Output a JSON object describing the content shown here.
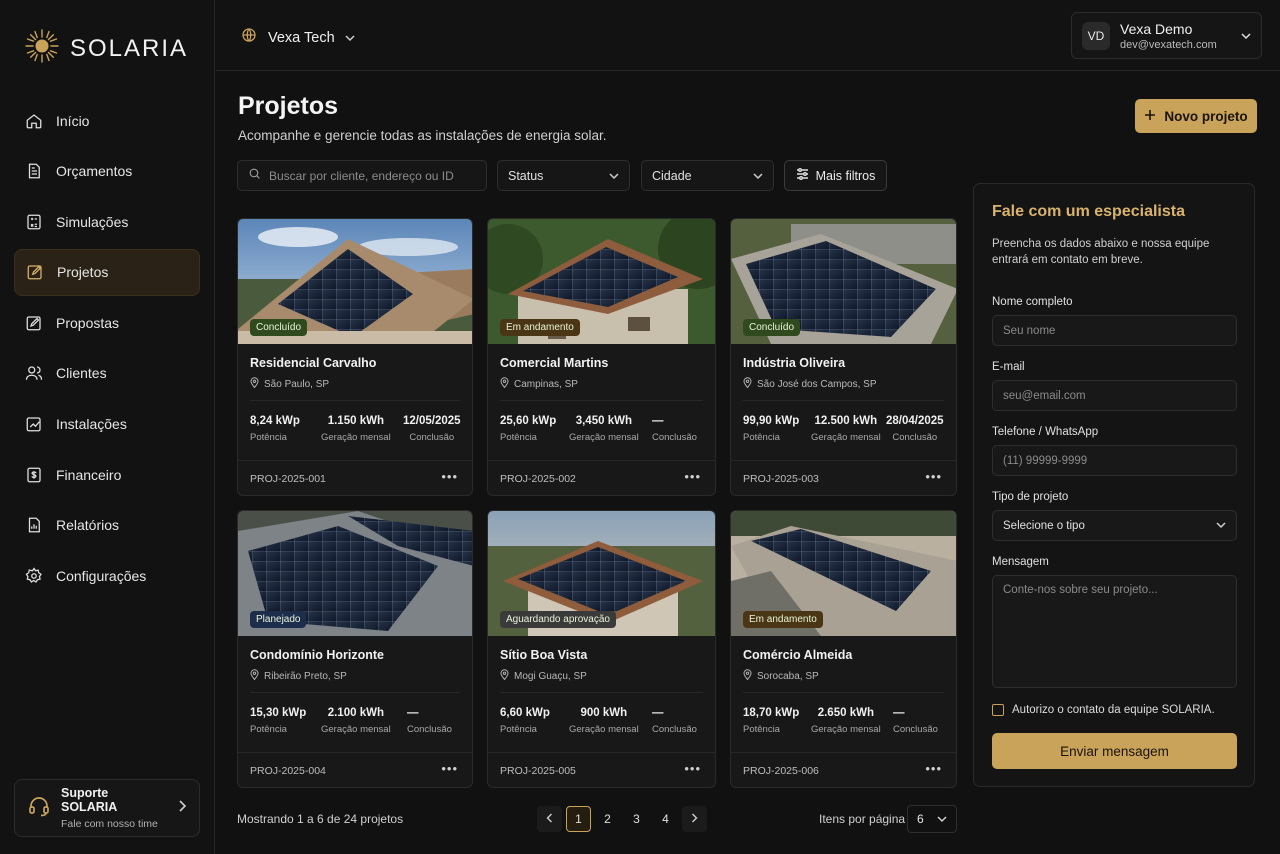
{
  "brand": {
    "name": "SOLARIA",
    "accent": "#c9a35a"
  },
  "sidebar": {
    "items": [
      {
        "label": "Início",
        "icon": "home-icon"
      },
      {
        "label": "Orçamentos",
        "icon": "document-icon"
      },
      {
        "label": "Simulações",
        "icon": "calculator-icon"
      },
      {
        "label": "Projetos",
        "icon": "edit-icon",
        "active": true
      },
      {
        "label": "Propostas",
        "icon": "proposal-icon"
      },
      {
        "label": "Clientes",
        "icon": "users-icon"
      },
      {
        "label": "Instalações",
        "icon": "installation-icon"
      },
      {
        "label": "Financeiro",
        "icon": "finance-icon"
      },
      {
        "label": "Relatórios",
        "icon": "report-icon"
      },
      {
        "label": "Configurações",
        "icon": "gear-icon"
      }
    ],
    "support": {
      "title": "Suporte SOLARIA",
      "subtitle": "Fale com nosso time"
    }
  },
  "topbar": {
    "org": "Vexa Tech",
    "user": {
      "initials": "VD",
      "name": "Vexa Demo",
      "email": "dev@vexatech.com"
    }
  },
  "main": {
    "title": "Projetos",
    "subtitle": "Acompanhe e gerencie todas as instalações de energia solar.",
    "new_button": "Novo projeto",
    "search_placeholder": "Buscar por cliente, endereço ou ID",
    "filters": {
      "status": "Status",
      "city": "Cidade",
      "more": "Mais filtros"
    },
    "stat_labels": {
      "power": "Potência",
      "generation": "Geração mensal",
      "completion": "Conclusão"
    },
    "projects": [
      {
        "name": "Residencial Carvalho",
        "location": "São Paulo, SP",
        "status": "Concluído",
        "status_kind": "conc",
        "power": "8,24 kWp",
        "generation": "1.150 kWh",
        "completion": "12/05/2025",
        "id": "PROJ-2025-001"
      },
      {
        "name": "Comercial Martins",
        "location": "Campinas, SP",
        "status": "Em andamento",
        "status_kind": "and",
        "power": "25,60 kWp",
        "generation": "3,450 kWh",
        "completion": "—",
        "id": "PROJ-2025-002"
      },
      {
        "name": "Indústria Oliveira",
        "location": "São José dos Campos, SP",
        "status": "Concluído",
        "status_kind": "conc",
        "power": "99,90 kWp",
        "generation": "12.500 kWh",
        "completion": "28/04/2025",
        "id": "PROJ-2025-003"
      },
      {
        "name": "Condomínio Horizonte",
        "location": "Ribeirão Preto, SP",
        "status": "Planejado",
        "status_kind": "plan",
        "power": "15,30 kWp",
        "generation": "2.100 kWh",
        "completion": "—",
        "id": "PROJ-2025-004"
      },
      {
        "name": "Sítio Boa Vista",
        "location": "Mogi Guaçu, SP",
        "status": "Aguardando aprovação",
        "status_kind": "agu",
        "power": "6,60 kWp",
        "generation": "900 kWh",
        "completion": "—",
        "id": "PROJ-2025-005"
      },
      {
        "name": "Comércio Almeida",
        "location": "Sorocaba, SP",
        "status": "Em andamento",
        "status_kind": "and",
        "power": "18,70 kWp",
        "generation": "2.650 kWh",
        "completion": "—",
        "id": "PROJ-2025-006"
      }
    ],
    "footer": {
      "showing": "Mostrando 1 a 6 de 24 projetos",
      "pages": [
        "1",
        "2",
        "3",
        "4"
      ],
      "current_page": "1",
      "items_per_page_label": "Itens por página",
      "items_per_page": "6"
    }
  },
  "contact_form": {
    "title": "Fale com um especialista",
    "description": "Preencha os dados abaixo e nossa equipe entrará em contato em breve.",
    "name_label": "Nome completo",
    "name_placeholder": "Seu nome",
    "email_label": "E-mail",
    "email_placeholder": "seu@email.com",
    "phone_label": "Telefone / WhatsApp",
    "phone_placeholder": "(11) 99999-9999",
    "type_label": "Tipo de projeto",
    "type_placeholder": "Selecione o tipo",
    "message_label": "Mensagem",
    "message_placeholder": "Conte-nos sobre seu projeto...",
    "consent": "Autorizo o contato da equipe SOLARIA.",
    "submit": "Enviar mensagem"
  }
}
